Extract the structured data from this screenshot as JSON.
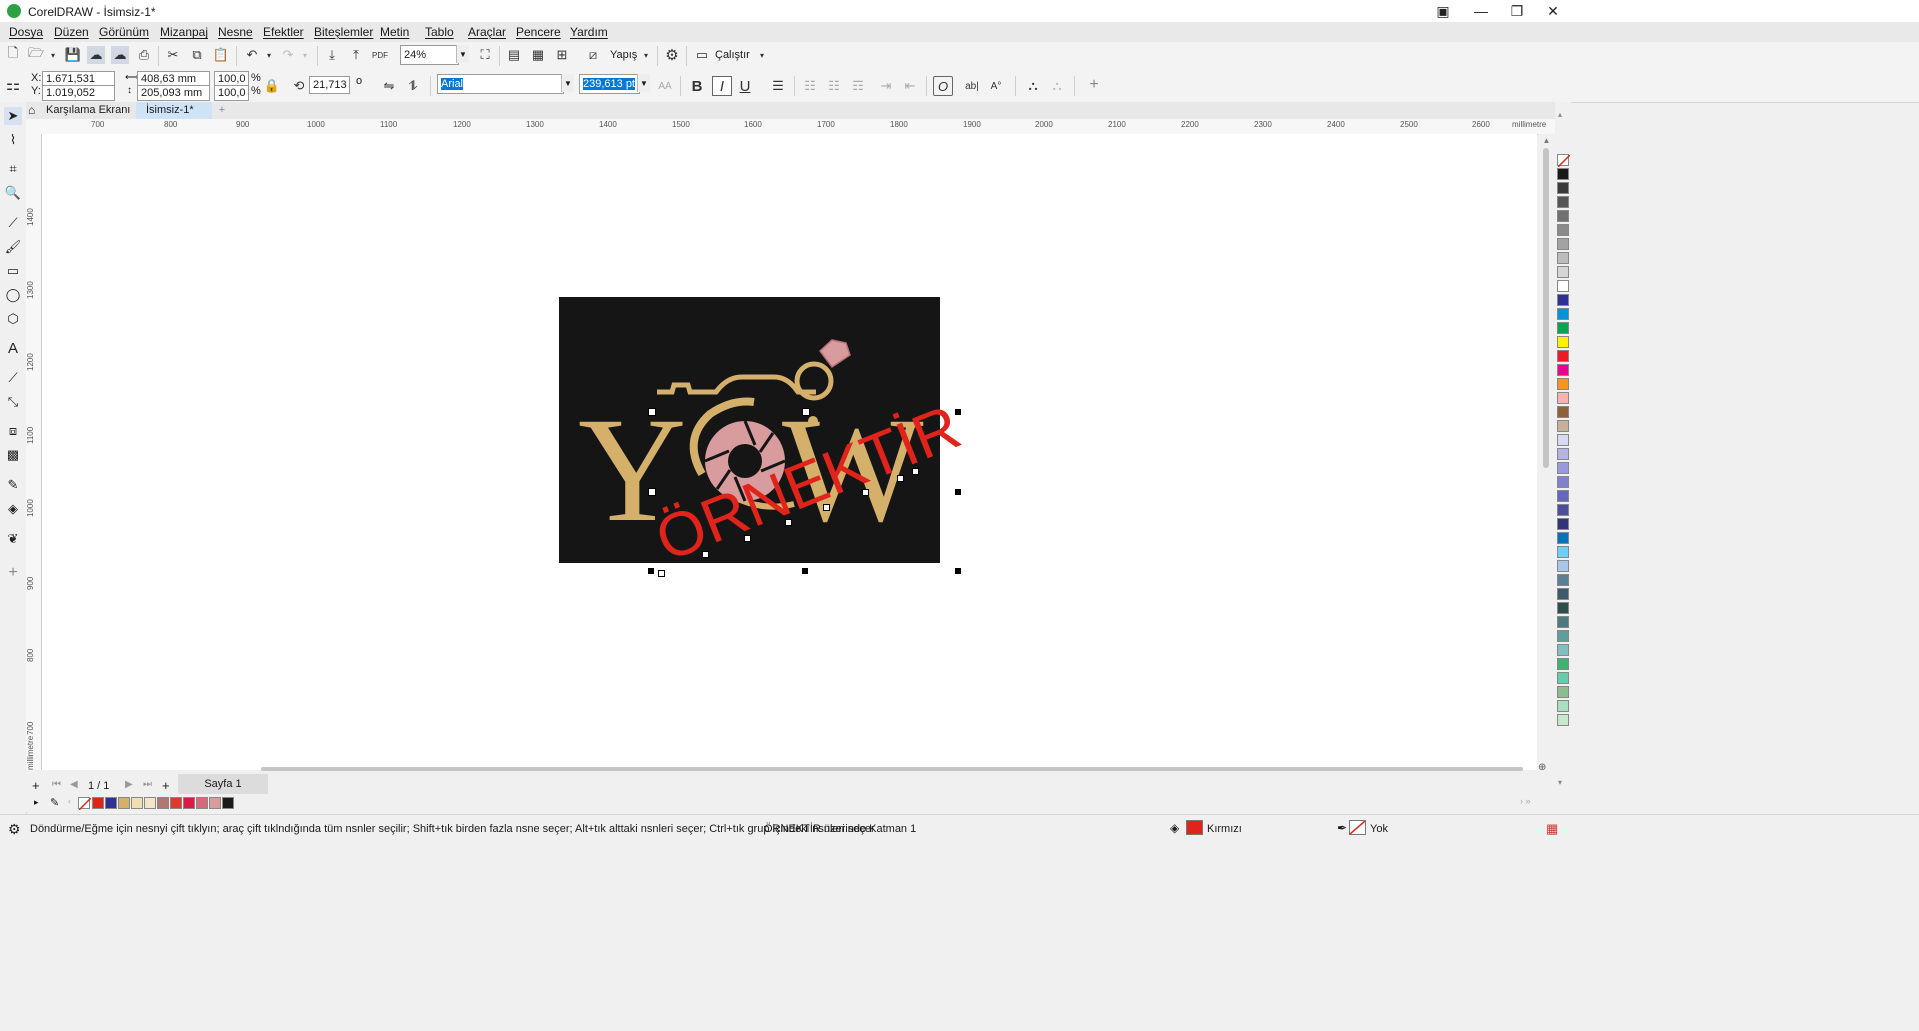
{
  "window": {
    "title": "CorelDRAW - İsimsiz-1*",
    "min_icon": "minimize-icon",
    "max_icon": "maximize-icon",
    "close_icon": "close-icon"
  },
  "menu": {
    "items": [
      "Dosya",
      "Düzen",
      "Görünüm",
      "Mizanpaj",
      "Nesne",
      "Efektler",
      "Biteşlemler",
      "Metin",
      "Tablo",
      "Araçlar",
      "Pencere",
      "Yardım"
    ]
  },
  "toolbar": {
    "zoom": "24%",
    "snap_label": "Yapış",
    "launch_label": "Çalıştır"
  },
  "propbar": {
    "x_label": "X:",
    "x_value": "1.671,531 mm",
    "y_label": "Y:",
    "y_value": "1.019,052 mm",
    "width_value": "408,63 mm",
    "height_value": "205,093 mm",
    "scale_x": "100,0",
    "scale_y": "100,0",
    "pct": "%",
    "rotation": "21,713",
    "degree": "o",
    "font": "Arial",
    "font_size": "239,613 pt",
    "bold": "B",
    "italic": "I",
    "underline": "U"
  },
  "tabs": {
    "welcome": "Karşılama Ekranı",
    "document": "İsimsiz-1*",
    "add": "+"
  },
  "ruler": {
    "h_ticks": [
      "700",
      "800",
      "900",
      "1000",
      "1100",
      "1200",
      "1300",
      "1400",
      "1500",
      "1600",
      "1700",
      "1800",
      "1900",
      "2000",
      "2100",
      "2200",
      "2300",
      "2400",
      "2500",
      "2600"
    ],
    "h_unit": "millimetre",
    "v_ticks": [
      "1400",
      "1300",
      "1200",
      "1100",
      "1000",
      "900",
      "800",
      "700"
    ],
    "v_unit": "millimetre"
  },
  "artwork": {
    "letter_left": "Y",
    "letter_right": "W",
    "watermark": "ÖRNEKTİR",
    "colors": {
      "background": "#151515",
      "gold": "#d4b06a",
      "rose": "#d99c9e",
      "watermark": "#e0241b"
    }
  },
  "pagenav": {
    "page_of": "1 / 1",
    "page_tab": "Sayfa 1"
  },
  "status": {
    "hint": "Döndürme/Eğme için nesnyi çift tıklyın; araç çift tıklndığında tüm nsnler seçilir; Shift+tık birden fazla nsne seçer; Alt+tık alttaki nsnleri seçer; Ctrl+tık grup içindeki nsnleri seçer",
    "object_info": "ÖRNEKTİR üzerinde Katman 1",
    "fill_label": "Kırmızı",
    "outline_label": "Yok",
    "fill_color": "#e0241b"
  },
  "palette": {
    "colors": [
      "#1a1a1a",
      "#3a3a3a",
      "#555555",
      "#707070",
      "#8a8a8a",
      "#a3a3a3",
      "#bcbcbc",
      "#d6d6d6",
      "#ffffff",
      "#2e3192",
      "#0093dd",
      "#00a651",
      "#fff200",
      "#ed1c24",
      "#ec008c",
      "#f7941d",
      "#f9b2b2",
      "#8c6239",
      "#c7b299",
      "#d9d9f3",
      "#b3b3e6",
      "#9999dd",
      "#8080cc",
      "#6666bb",
      "#4d4d99",
      "#333377",
      "#0072bc",
      "#6dcff6",
      "#a7c7e7",
      "#5b7f95",
      "#3d5a6c",
      "#2f4f4f",
      "#4a7c7c",
      "#5f9e9e",
      "#7fbfbf",
      "#3cb371",
      "#66cdaa",
      "#8fbc8f",
      "#a9dfbf",
      "#c8e6c9"
    ],
    "doc_colors": [
      "#e0241b",
      "#2e3192",
      "#d4b06a",
      "#efe0b0",
      "#f3e6c8",
      "#b07870",
      "#e03a2a",
      "#e0184a",
      "#d46a7a",
      "#d99c9e",
      "#1a1a1a"
    ]
  }
}
